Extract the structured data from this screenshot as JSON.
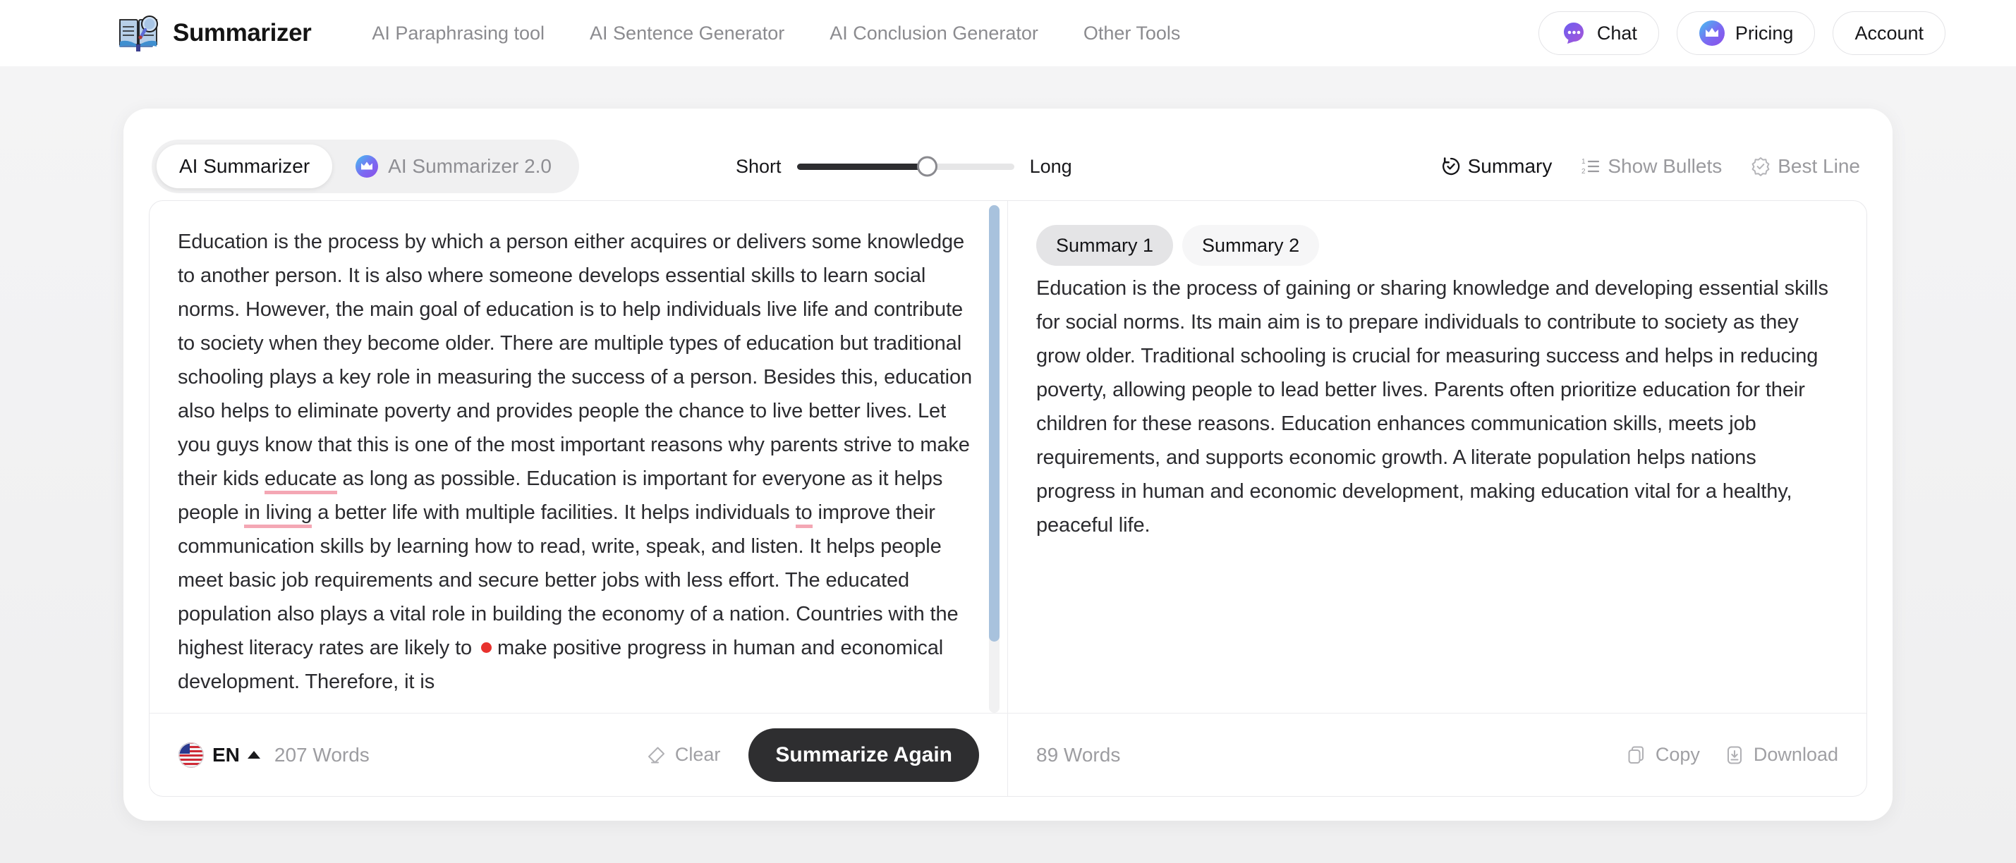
{
  "header": {
    "logo_icon": "book-magnifier-icon",
    "brand": "Summarizer",
    "nav": [
      {
        "label": "AI Paraphrasing tool"
      },
      {
        "label": "AI Sentence Generator"
      },
      {
        "label": "AI Conclusion Generator"
      },
      {
        "label": "Other Tools"
      }
    ],
    "chat": {
      "label": "Chat",
      "icon": "chat-bubble-icon"
    },
    "pricing": {
      "label": "Pricing",
      "icon": "crown-icon"
    },
    "account": {
      "label": "Account"
    }
  },
  "toolbar": {
    "tabs": [
      {
        "label": "AI Summarizer",
        "active": true,
        "icon": null
      },
      {
        "label": "AI Summarizer 2.0",
        "active": false,
        "icon": "crown-icon"
      }
    ],
    "slider": {
      "min_label": "Short",
      "max_label": "Long",
      "value_percent": 60
    },
    "modes": [
      {
        "label": "Summary",
        "icon": "history-check-icon",
        "active": true
      },
      {
        "label": "Show Bullets",
        "icon": "numbered-list-icon",
        "active": false
      },
      {
        "label": "Best Line",
        "icon": "badge-check-icon",
        "active": false
      }
    ]
  },
  "input_pane": {
    "text_parts": [
      {
        "t": "Education is the process by which a person either acquires or delivers some knowledge to another person. It is also where someone develops essential skills to learn social norms. However, the main goal of education is to help individuals live life and contribute to society when they become older. There are multiple types of education but traditional schooling plays a key role in measuring the success of a person. Besides this, education also helps to eliminate poverty and provides people the chance to live better lives. Let you guys know that this is one of the most important reasons why parents strive to make their kids "
      },
      {
        "t": "educate",
        "error": true
      },
      {
        "t": " as long as possible. Education is important for everyone as it helps people "
      },
      {
        "t": "in living",
        "error": true
      },
      {
        "t": " a better life with multiple facilities. It helps individuals "
      },
      {
        "t": "to",
        "error": true
      },
      {
        "t": " improve their communication skills by learning how to read, write, speak, and listen. It helps people meet basic job requirements and secure better jobs with less effort. The educated population also plays a vital role in building the economy of a nation. Countries with the highest literacy rates are likely to "
      },
      {
        "t": "",
        "dot": true
      },
      {
        "t": " make positive progress in human and economical development. Therefore, it is"
      }
    ],
    "footer": {
      "language": "EN",
      "flag_icon": "us-flag-icon",
      "caret_icon": "caret-up-icon",
      "word_count": "207 Words",
      "clear": {
        "label": "Clear",
        "icon": "eraser-icon"
      },
      "submit": {
        "label": "Summarize Again"
      }
    }
  },
  "output_pane": {
    "tabs": [
      {
        "label": "Summary 1",
        "active": true
      },
      {
        "label": "Summary 2",
        "active": false
      }
    ],
    "text": "Education is the process of gaining or sharing knowledge and developing essential skills for social norms. Its main aim is to prepare individuals to contribute to society as they grow older. Traditional schooling is crucial for measuring success and helps in reducing poverty, allowing people to lead better lives. Parents often prioritize education for their children for these reasons. Education enhances communication skills, meets job requirements, and supports economic growth. A literate population helps nations progress in human and economic development, making education vital for a healthy, peaceful life.",
    "footer": {
      "word_count": "89 Words",
      "copy": {
        "label": "Copy",
        "icon": "copy-icon"
      },
      "download": {
        "label": "Download",
        "icon": "download-icon"
      }
    }
  },
  "colors": {
    "page_bg": "#f2f2f3",
    "card_bg": "#ffffff",
    "accent_dark": "#2e2e30",
    "error_underline": "#f4a7b4",
    "dot_marker": "#e8322e",
    "scrollbar_thumb": "#a8c2dd"
  }
}
